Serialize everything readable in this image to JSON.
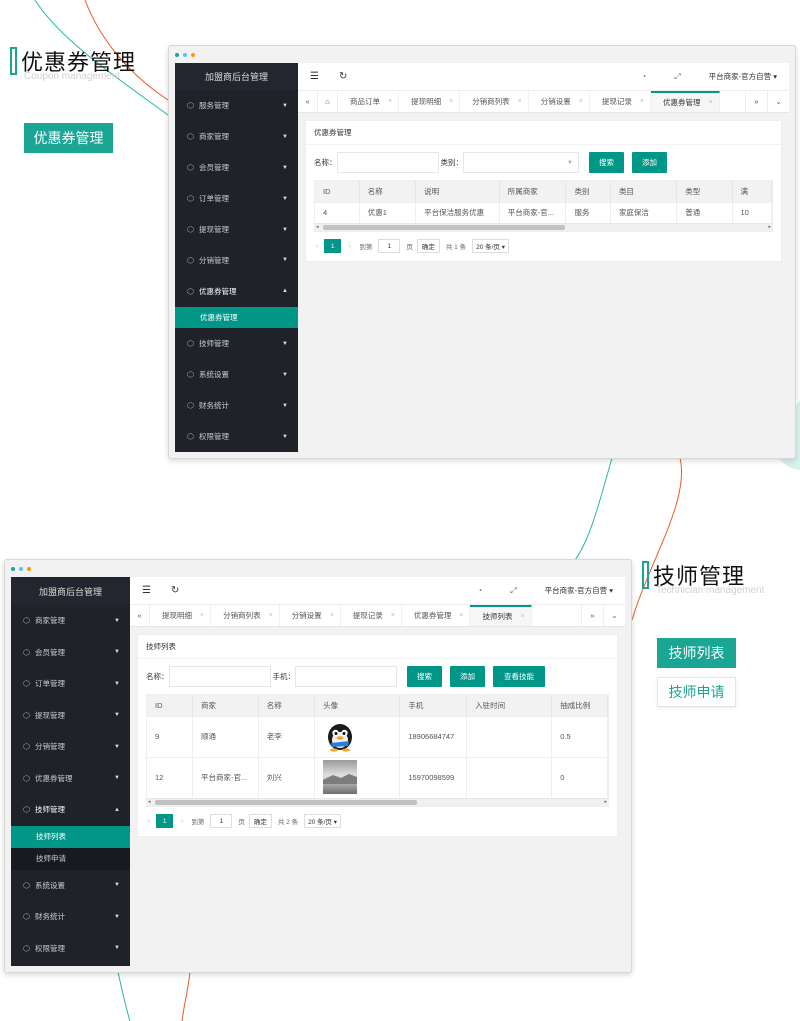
{
  "section1": {
    "title": "优惠券管理",
    "subtitle": "Coupon management",
    "tag": "优惠券管理"
  },
  "section2": {
    "title": "技师管理",
    "subtitle": "Technician management",
    "tags": [
      "技师列表",
      "技师申请"
    ]
  },
  "app1": {
    "logo": "加盟商后台管理",
    "user": "平台商家-官方自营",
    "menu": [
      "服务管理",
      "商家管理",
      "会员管理",
      "订单管理",
      "提现管理",
      "分销管理",
      "优惠券管理",
      "技师管理",
      "系统设置",
      "财务统计",
      "权限管理"
    ],
    "submenu": [
      "优惠券管理"
    ],
    "tabs": [
      "商品订单",
      "提现明细",
      "分销商列表",
      "分销设置",
      "提现记录",
      "优惠券管理"
    ],
    "card_title": "优惠券管理",
    "form": {
      "name_label": "名称：",
      "type_label": "类别：",
      "search": "搜索",
      "add": "添加"
    },
    "columns": [
      "ID",
      "名称",
      "说明",
      "所属商家",
      "类别",
      "类目",
      "类型",
      "满"
    ],
    "rows": [
      [
        "4",
        "优惠1",
        "平台保洁服务优惠",
        "平台商家-官...",
        "服务",
        "家庭保洁",
        "普通",
        "10"
      ]
    ],
    "pager": {
      "page": "1",
      "goto": "到第",
      "page_unit": "页",
      "confirm": "确定",
      "total": "共 1 条",
      "size": "20 条/页 ▾"
    }
  },
  "app2": {
    "logo": "加盟商后台管理",
    "user": "平台商家-官方自营",
    "menu": [
      "商家管理",
      "会员管理",
      "订单管理",
      "提现管理",
      "分销管理",
      "优惠券管理",
      "技师管理",
      "系统设置",
      "财务统计",
      "权限管理"
    ],
    "submenu": [
      "技师列表",
      "技师申请"
    ],
    "tabs": [
      "提现明细",
      "分销商列表",
      "分销设置",
      "提现记录",
      "优惠券管理",
      "技师列表"
    ],
    "card_title": "技师列表",
    "form": {
      "name_label": "名称：",
      "phone_label": "手机：",
      "search": "搜索",
      "add": "添加",
      "skills": "查看技能"
    },
    "columns": [
      "ID",
      "商家",
      "名称",
      "头像",
      "手机",
      "入驻时间",
      "抽成比例"
    ],
    "rows": [
      [
        "9",
        "顺通",
        "老李",
        "",
        "18906684747",
        "",
        "0.5"
      ],
      [
        "12",
        "平台商家-官...",
        "刘兴",
        "",
        "15970098599",
        "",
        "0"
      ]
    ],
    "pager": {
      "page": "1",
      "goto": "到第",
      "page_unit": "页",
      "confirm": "确定",
      "total": "共 2 条",
      "size": "20 条/页 ▾"
    }
  },
  "colors": {
    "accent": "#1aa594",
    "sidebar": "#20222a",
    "curve_teal": "#2bb5a5",
    "curve_orange": "#f05a28"
  }
}
